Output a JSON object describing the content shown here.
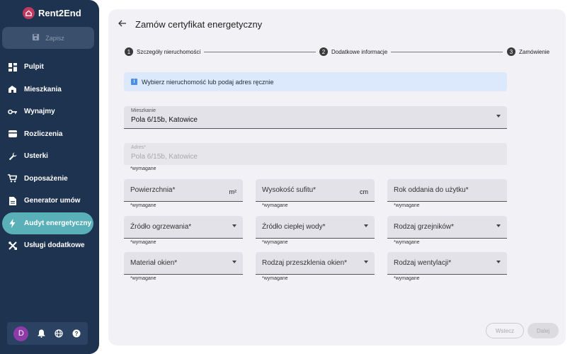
{
  "app": {
    "name": "Rent2End"
  },
  "sidebar": {
    "save_label": "Zapisz",
    "items": [
      {
        "label": "Pulpit",
        "icon": "dashboard-icon"
      },
      {
        "label": "Mieszkania",
        "icon": "house-icon"
      },
      {
        "label": "Wynajmy",
        "icon": "key-icon"
      },
      {
        "label": "Rozliczenia",
        "icon": "card-icon"
      },
      {
        "label": "Usterki",
        "icon": "wrench-icon"
      },
      {
        "label": "Doposażenie",
        "icon": "cart-icon"
      },
      {
        "label": "Generator umów",
        "icon": "document-icon"
      },
      {
        "label": "Audyt energetyczny",
        "icon": "bolt-icon",
        "active": true
      },
      {
        "label": "Usługi dodatkowe",
        "icon": "tools-icon"
      }
    ],
    "avatar_letter": "D"
  },
  "header": {
    "title": "Zamów certyfikat energetyczny"
  },
  "stepper": [
    {
      "num": "1",
      "label": "Szczegóły nieruchomości"
    },
    {
      "num": "2",
      "label": "Dodatkowe informacje"
    },
    {
      "num": "3",
      "label": "Zamówienie"
    }
  ],
  "info": {
    "text": "Wybierz nieruchomość lub podaj adres ręcznie"
  },
  "form": {
    "apartment": {
      "label": "Mieszkanie",
      "value": "Pola 6/15b, Katowice"
    },
    "address": {
      "label": "Adres*",
      "value": "Pola 6/15b, Katowice",
      "required": "*wymagane"
    },
    "area": {
      "label": "Powierzchnia*",
      "unit": "m²",
      "required": "*wymagane"
    },
    "height": {
      "label": "Wysokość sufitu*",
      "unit": "cm",
      "required": "*wymagane"
    },
    "year": {
      "label": "Rok oddania do użytku*",
      "required": "*wymagane"
    },
    "heating": {
      "label": "Źródło ogrzewania*",
      "required": "*wymagane"
    },
    "hot_water": {
      "label": "Źródło ciepłej wody*",
      "required": "*wymagane"
    },
    "radiators": {
      "label": "Rodzaj grzejników*",
      "required": "*wymagane"
    },
    "window_material": {
      "label": "Materiał okien*",
      "required": "*wymagane"
    },
    "glazing": {
      "label": "Rodzaj przeszklenia okien*",
      "required": "*wymagane"
    },
    "ventilation": {
      "label": "Rodzaj wentylacji*",
      "required": "*wymagane"
    }
  },
  "buttons": {
    "back": "Wstecz",
    "next": "Dalej"
  },
  "colors": {
    "sidebar": "#1e3350",
    "active": "#5ab0b8",
    "brand": "#c0395e"
  }
}
